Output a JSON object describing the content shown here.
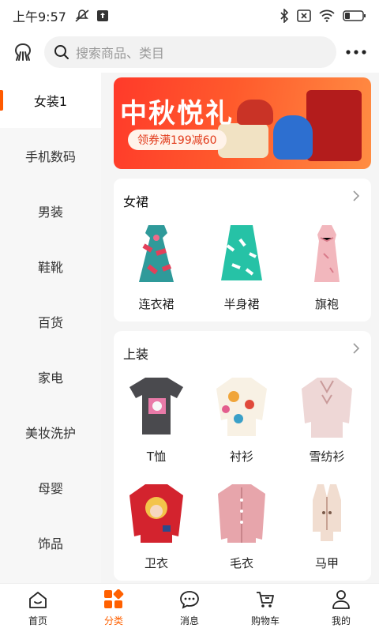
{
  "status": {
    "time": "上午9:57"
  },
  "header": {
    "search_placeholder": "搜索商品、类目"
  },
  "sidebar": {
    "items": [
      {
        "label": "女装1",
        "active": true
      },
      {
        "label": "手机数码"
      },
      {
        "label": "男装"
      },
      {
        "label": "鞋靴"
      },
      {
        "label": "百货"
      },
      {
        "label": "家电"
      },
      {
        "label": "美妆洗护"
      },
      {
        "label": "母婴"
      },
      {
        "label": "饰品"
      }
    ]
  },
  "banner": {
    "title": "中秋悦礼",
    "coupon": "领券满199减60"
  },
  "sections": [
    {
      "title": "女裙",
      "items": [
        {
          "label": "连衣裙"
        },
        {
          "label": "半身裙"
        },
        {
          "label": "旗袍"
        }
      ]
    },
    {
      "title": "上装",
      "items": [
        {
          "label": "T恤"
        },
        {
          "label": "衬衫"
        },
        {
          "label": "雪纺衫"
        },
        {
          "label": "卫衣"
        },
        {
          "label": "毛衣"
        },
        {
          "label": "马甲"
        }
      ]
    }
  ],
  "bottom_nav": {
    "items": [
      {
        "label": "首页"
      },
      {
        "label": "分类",
        "active": true
      },
      {
        "label": "消息"
      },
      {
        "label": "购物车"
      },
      {
        "label": "我的"
      }
    ]
  },
  "colors": {
    "accent": "#ff6000",
    "banner_start": "#ff3a2a",
    "banner_end": "#ff8d43"
  }
}
